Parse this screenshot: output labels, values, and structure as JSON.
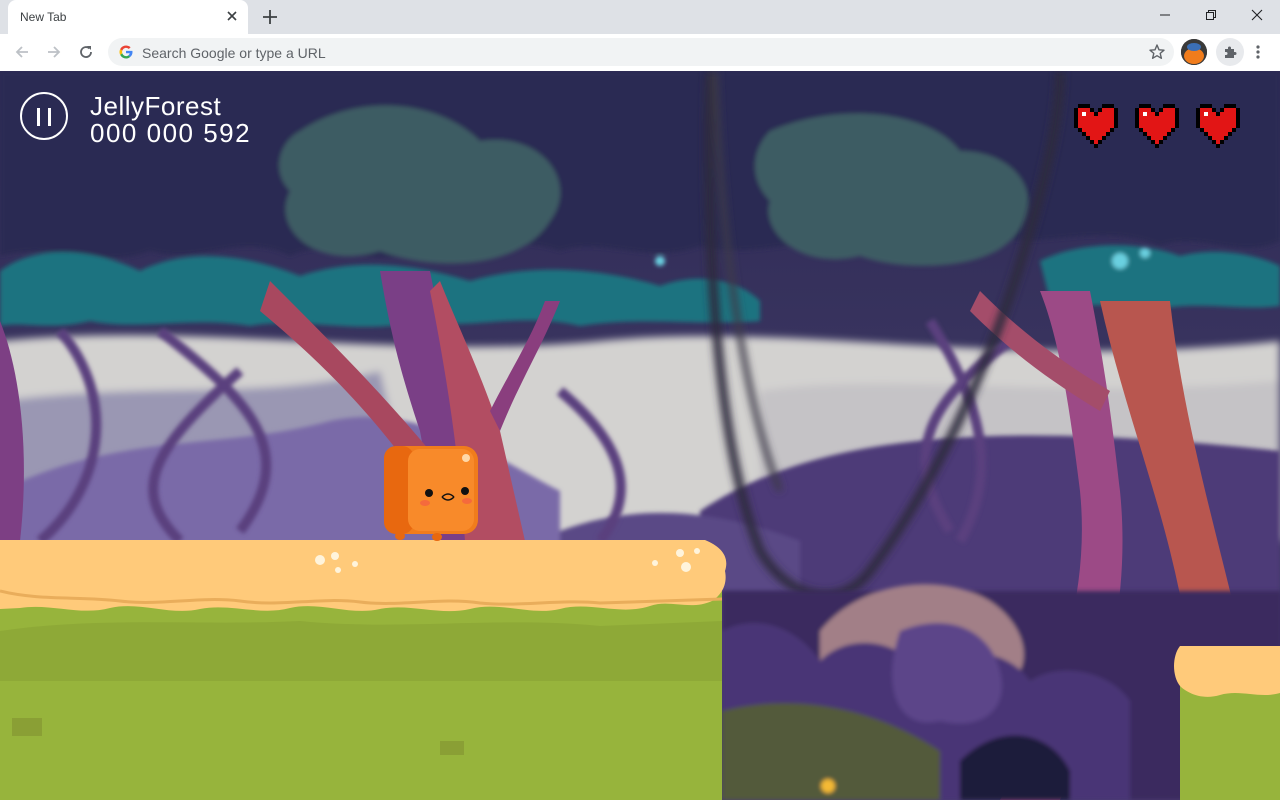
{
  "browser": {
    "tab_title": "New Tab",
    "omnibox_placeholder": "Search Google or type a URL"
  },
  "game": {
    "title": "JellyForest",
    "score": "000 000 592",
    "hearts": 3,
    "colors": {
      "hud_text": "#ffffff",
      "heart": "#e21515",
      "character": "#f07c1c",
      "platform_top": "#ffca7a",
      "grass": "#97b43c"
    }
  }
}
